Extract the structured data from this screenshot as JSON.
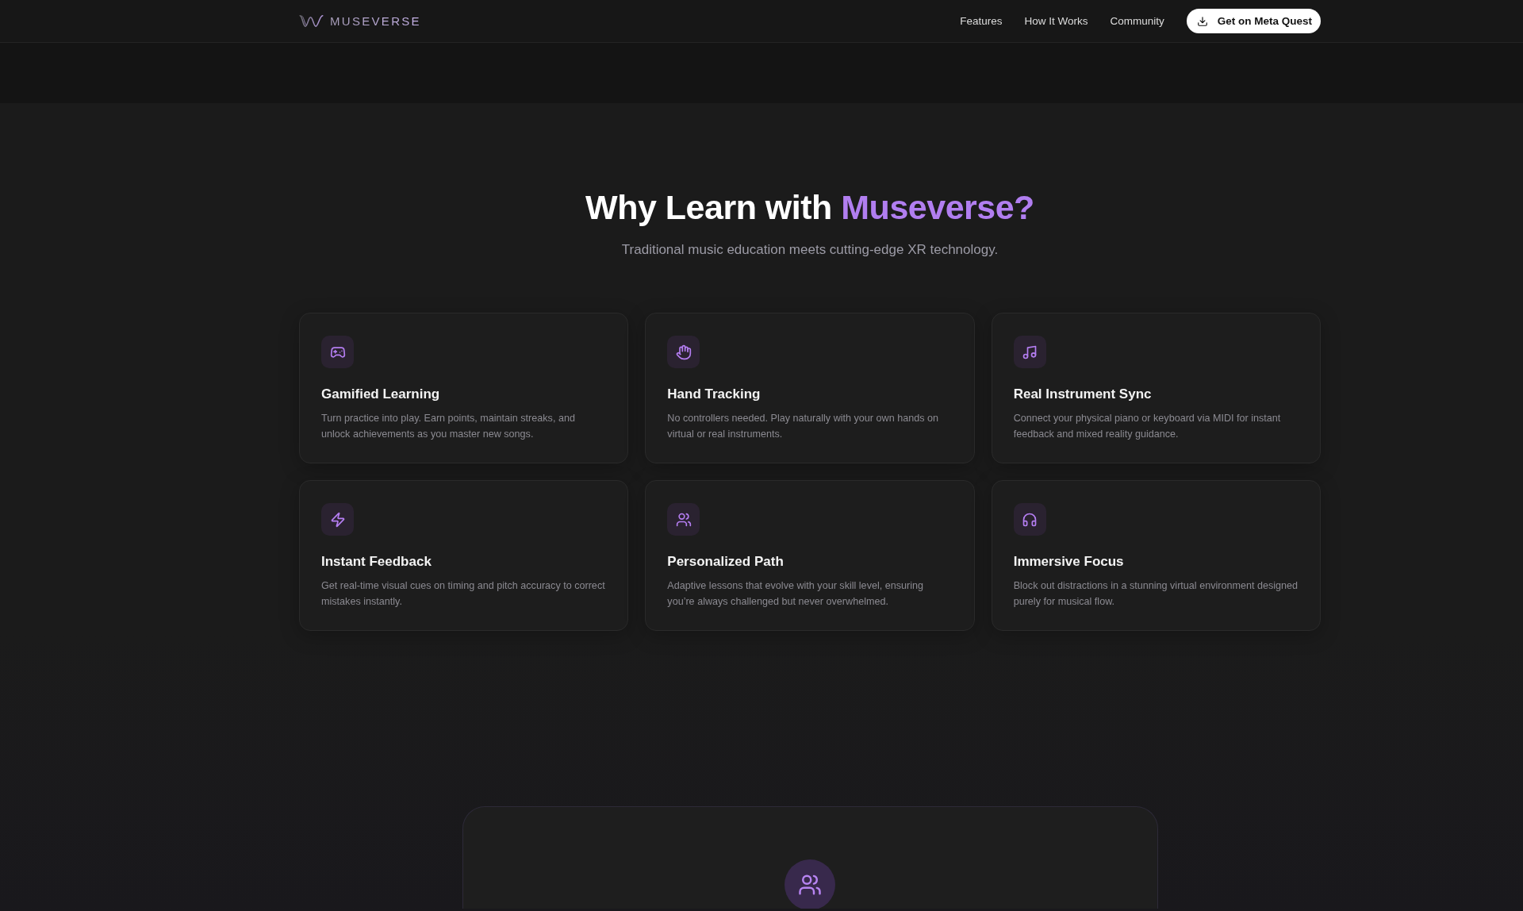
{
  "header": {
    "logo": {
      "text": "MUSEVERSE"
    },
    "nav": [
      "Features",
      "How It Works",
      "Community"
    ],
    "cta": {
      "label": "Get on Meta Quest"
    }
  },
  "features": {
    "title": {
      "text": "Why Learn with",
      "highlight": "Museverse?"
    },
    "subtitle": "Traditional music education meets cutting-edge XR technology.",
    "cards": [
      {
        "title": "Gamified Learning",
        "description": "Turn practice into play. Earn points, maintain streaks, and unlock achievements as you master new songs."
      },
      {
        "title": "Hand Tracking",
        "description": "No controllers needed. Play naturally with your own hands on virtual or real instruments."
      },
      {
        "title": "Real Instrument Sync",
        "description": "Connect your physical piano or keyboard via MIDI for instant feedback and mixed reality guidance."
      },
      {
        "title": "Instant Feedback",
        "description": "Get real-time visual cues on timing and pitch accuracy to correct mistakes instantly."
      },
      {
        "title": "Personalized Path",
        "description": "Adaptive lessons that evolve with your skill level, ensuring you’re always challenged but never overwhelmed."
      },
      {
        "title": "Immersive Focus",
        "description": "Block out distractions in a stunning virtual environment designed purely for musical flow."
      }
    ]
  }
}
